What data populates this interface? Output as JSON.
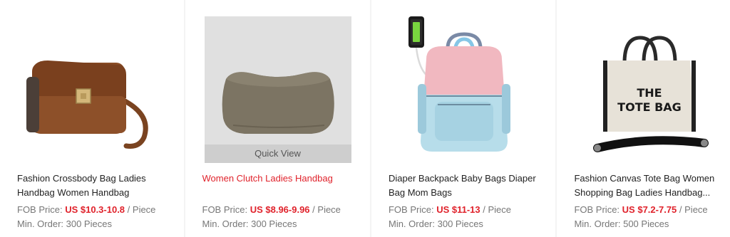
{
  "products": [
    {
      "title": "Fashion Crossbody Bag Ladies Handbag Women Handbag",
      "price_label": "FOB Price:",
      "price_value": "US $10.3-10.8",
      "price_unit": "/ Piece",
      "moq": "Min. Order: 300 Pieces",
      "image_icon": "brown-crossbody-bag"
    },
    {
      "title": "Women Clutch Ladies Handbag",
      "price_label": "FOB Price:",
      "price_value": "US $8.96-9.96",
      "price_unit": "/ Piece",
      "moq": "Min. Order: 300 Pieces",
      "image_icon": "taupe-clutch-bag",
      "quick_view": "Quick View"
    },
    {
      "title": "Diaper Backpack Baby Bags Diaper Bag Mom Bags",
      "price_label": "FOB Price:",
      "price_value": "US $11-13",
      "price_unit": "/ Piece",
      "moq": "Min. Order: 300 Pieces",
      "image_icon": "pink-blue-diaper-backpack"
    },
    {
      "title": "Fashion Canvas Tote Bag Women Shopping Bag Ladies Handbag...",
      "price_label": "FOB Price:",
      "price_value": "US $7.2-7.75",
      "price_unit": "/ Piece",
      "moq": "Min. Order: 500 Pieces",
      "image_icon": "canvas-tote-bag",
      "image_text_1": "THE",
      "image_text_2": "TOTE BAG"
    }
  ],
  "colors": {
    "price_red": "#e0222b",
    "title_hover_red": "#e0222b",
    "card_bg": "#ffffff",
    "page_bg": "#f4f4f4"
  }
}
